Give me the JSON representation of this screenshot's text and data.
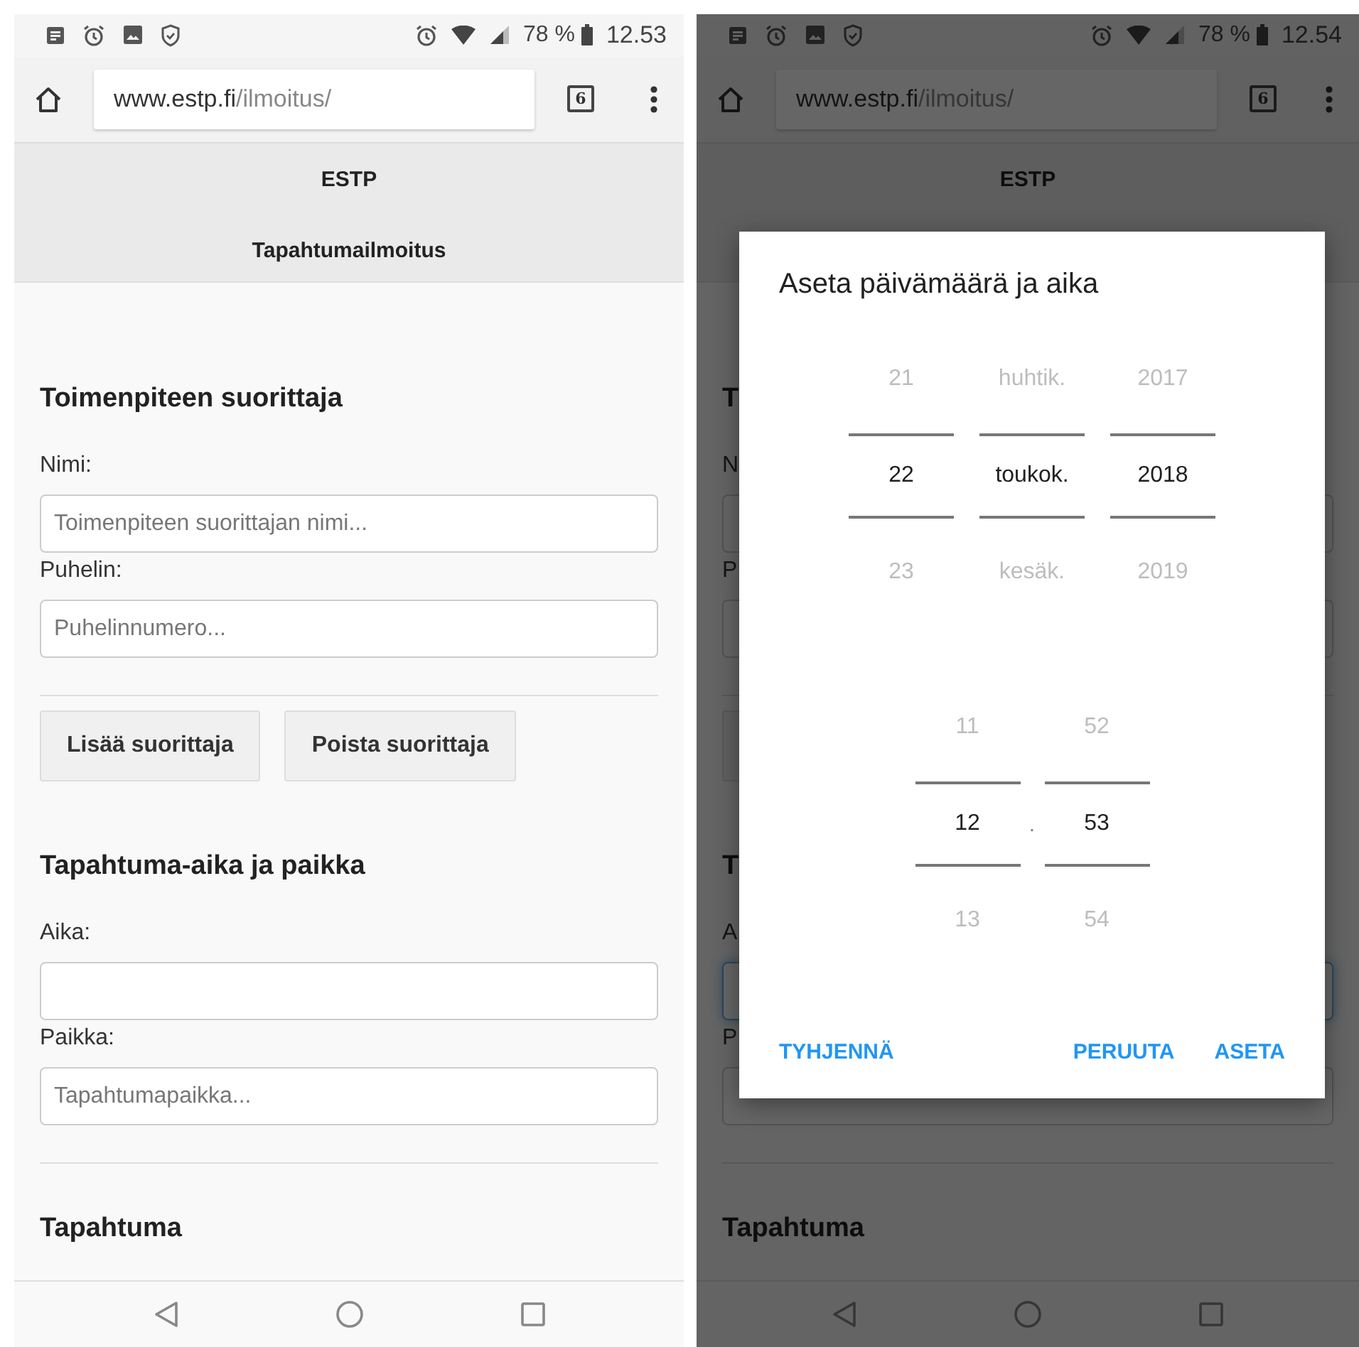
{
  "screens": [
    {
      "status_bar": {
        "battery": "78 %",
        "time": "12.53"
      },
      "browser": {
        "url_host": "www.estp.fi",
        "url_path": "/ilmoitus/",
        "tab_count": "6"
      },
      "header": {
        "site": "ESTP",
        "title": "Tapahtumailmoitus"
      },
      "form": [
        {
          "kind": "heading",
          "text": "Toimenpiteen suorittaja"
        },
        {
          "kind": "label",
          "text": "Nimi:"
        },
        {
          "kind": "field",
          "placeholder": "Toimenpiteen suorittajan nimi...",
          "focused": false
        },
        {
          "kind": "label",
          "text": "Puhelin:"
        },
        {
          "kind": "field",
          "placeholder": "Puhelinnumero...",
          "focused": false
        },
        {
          "kind": "divider"
        },
        {
          "kind": "button_row",
          "buttons": [
            "Lisää suorittaja",
            "Poista suorittaja"
          ]
        },
        {
          "kind": "heading",
          "text": "Tapahtuma-aika ja paikka"
        },
        {
          "kind": "label",
          "text": "Aika:"
        },
        {
          "kind": "field",
          "focused": false
        },
        {
          "kind": "label",
          "text": "Paikka:"
        },
        {
          "kind": "field",
          "placeholder": "Tapahtumapaikka...",
          "focused": false
        },
        {
          "kind": "divider"
        },
        {
          "kind": "heading",
          "text": "Tapahtuma"
        }
      ]
    },
    {
      "status_bar": {
        "battery": "78 %",
        "time": "12.54"
      },
      "browser": {
        "url_host": "www.estp.fi",
        "url_path": "/ilmoitus/",
        "tab_count": "6"
      },
      "header": {
        "site": "ESTP"
      },
      "form": [
        {
          "kind": "heading",
          "text": "T"
        },
        {
          "kind": "label",
          "text": "N"
        },
        {
          "kind": "field",
          "focused": false
        },
        {
          "kind": "label",
          "text": "P"
        },
        {
          "kind": "field",
          "focused": false
        },
        {
          "kind": "divider"
        },
        {
          "kind": "covered_button"
        },
        {
          "kind": "heading",
          "text": "T"
        },
        {
          "kind": "label",
          "text": "A"
        },
        {
          "kind": "field",
          "focused": true
        },
        {
          "kind": "label",
          "text": "P"
        },
        {
          "kind": "field",
          "focused": false
        },
        {
          "kind": "divider"
        },
        {
          "kind": "heading",
          "text": "Tapahtuma"
        }
      ],
      "dialog": {
        "title": "Aseta päivämäärä ja aika",
        "date_columns": [
          [
            {
              "text": "21",
              "selected": false
            },
            {
              "text": "22",
              "selected": true
            },
            {
              "text": "23",
              "selected": false
            }
          ],
          [
            {
              "text": "huhtik.",
              "selected": false
            },
            {
              "text": "toukok.",
              "selected": true
            },
            {
              "text": "kesäk.",
              "selected": false
            }
          ],
          [
            {
              "text": "2017",
              "selected": false
            },
            {
              "text": "2018",
              "selected": true
            },
            {
              "text": "2019",
              "selected": false
            }
          ]
        ],
        "time_columns": [
          [
            {
              "text": "11",
              "selected": false
            },
            {
              "text": "12",
              "selected": true
            },
            {
              "text": "13",
              "selected": false
            }
          ],
          [
            {
              "text": "52",
              "selected": false
            },
            {
              "text": "53",
              "selected": true
            },
            {
              "text": "54",
              "selected": false
            }
          ]
        ],
        "time_separator": ".",
        "clear_button": "TYHJENNÄ",
        "cancel_button": "PERUUTA",
        "set_button": "ASETA"
      }
    }
  ]
}
